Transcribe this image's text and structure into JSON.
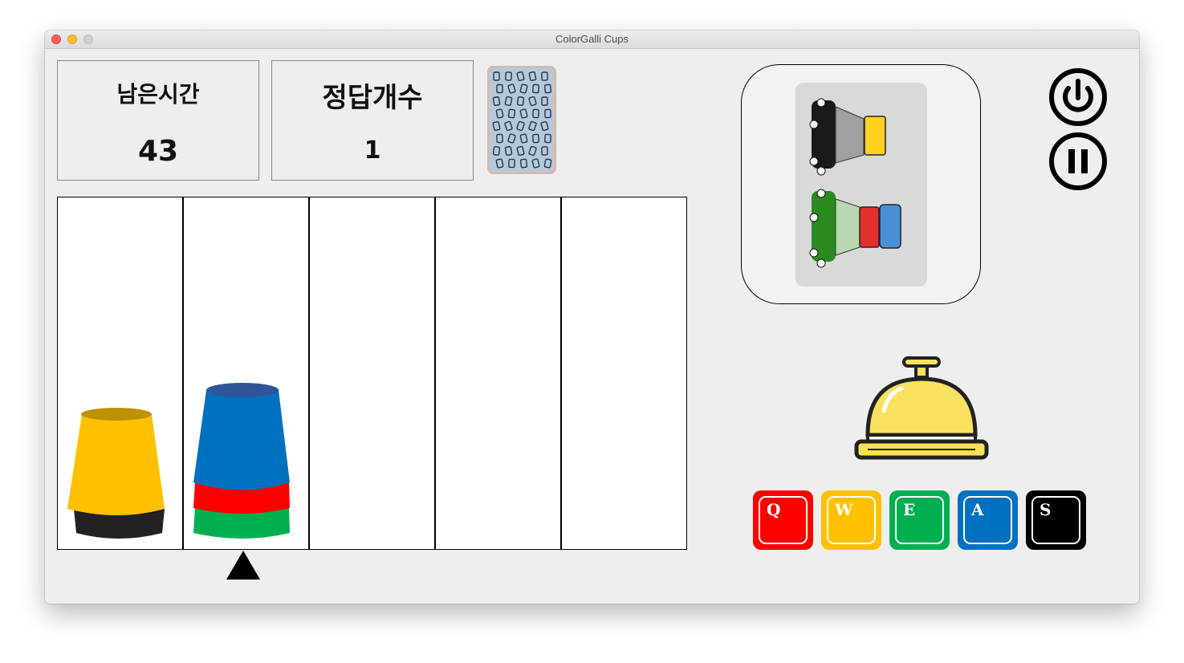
{
  "window": {
    "title": "ColorGalli Cups"
  },
  "timer": {
    "label": "남은시간",
    "value": "43"
  },
  "score": {
    "label": "정답개수",
    "value": "1"
  },
  "colors": {
    "yellow": "#ffc000",
    "black": "#222222",
    "blue": "#0070c0",
    "red": "#ff0000",
    "green": "#00b050",
    "bell": "#f9e15f"
  },
  "columns": [
    {
      "cups_bottom_to_top": [
        "black",
        "yellow"
      ]
    },
    {
      "cups_bottom_to_top": [
        "green",
        "red",
        "blue"
      ]
    },
    {
      "cups_bottom_to_top": []
    },
    {
      "cups_bottom_to_top": []
    },
    {
      "cups_bottom_to_top": []
    }
  ],
  "selected_column": 2,
  "target_card": {
    "top_car": {
      "color": "black",
      "cargo": [
        "yellow"
      ]
    },
    "bottom_car": {
      "color": "green",
      "cargo": [
        "red",
        "blue"
      ]
    }
  },
  "controls": {
    "power_icon": "power-icon",
    "pause_icon": "pause-icon",
    "bell_icon": "bell-icon"
  },
  "keys": [
    {
      "letter": "Q",
      "color": "#ff0000"
    },
    {
      "letter": "W",
      "color": "#ffc000"
    },
    {
      "letter": "E",
      "color": "#00b050"
    },
    {
      "letter": "A",
      "color": "#0070c0"
    },
    {
      "letter": "S",
      "color": "#000000"
    }
  ]
}
